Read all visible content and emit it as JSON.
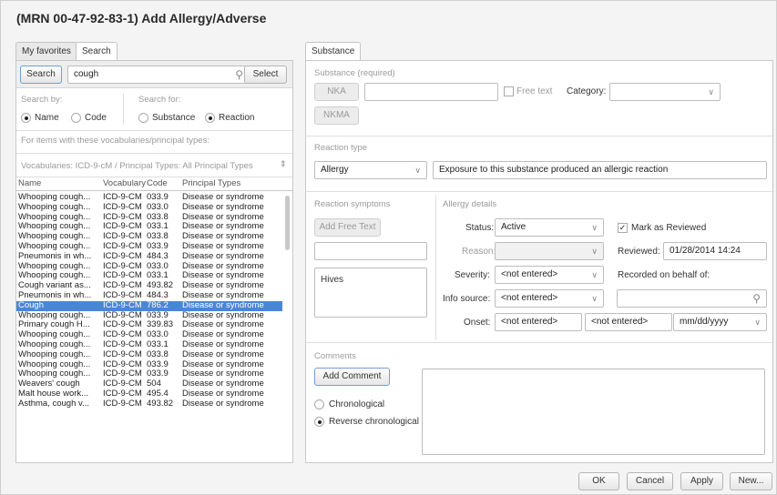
{
  "title": "(MRN 00-47-92-83-1) Add Allergy/Adverse",
  "left_tabs": [
    "My favorites",
    "Search"
  ],
  "search": {
    "button": "Search",
    "query": "cough",
    "select_button": "Select"
  },
  "search_by": {
    "label": "Search by:",
    "options": [
      "Name",
      "Code"
    ]
  },
  "search_for": {
    "label": "Search for:",
    "options": [
      "Substance",
      "Reaction"
    ]
  },
  "vocab_note": "For items with these vocabularies/principal types:",
  "vocab_select": "Vocabularies: ICD-9-cM / Principal Types: All Principal Types",
  "results": {
    "headers": [
      "Name",
      "Vocabulary",
      "Code",
      "Principal Types"
    ],
    "rows": [
      [
        "Whooping cough...",
        "ICD-9-CM",
        "033.9",
        "Disease or syndrome"
      ],
      [
        "Whooping cough...",
        "ICD-9-CM",
        "033.0",
        "Disease or syndrome"
      ],
      [
        "Whooping cough...",
        "ICD-9-CM",
        "033.8",
        "Disease or syndrome"
      ],
      [
        "Whooping cough...",
        "ICD-9-CM",
        "033.1",
        "Disease or syndrome"
      ],
      [
        "Whooping cough...",
        "ICD-9-CM",
        "033.8",
        "Disease or syndrome"
      ],
      [
        "Whooping cough...",
        "ICD-9-CM",
        "033.9",
        "Disease or syndrome"
      ],
      [
        "Pneumonis in wh...",
        "ICD-9-CM",
        "484.3",
        "Disease or syndrome"
      ],
      [
        "Whooping cough...",
        "ICD-9-CM",
        "033.0",
        "Disease or syndrome"
      ],
      [
        "Whooping cough...",
        "ICD-9-CM",
        "033.1",
        "Disease or syndrome"
      ],
      [
        "Cough variant as...",
        "ICD-9-CM",
        "493.82",
        "Disease or syndrome"
      ],
      [
        "Pneumonis in wh...",
        "ICD-9-CM",
        "484.3",
        "Disease or syndrome"
      ],
      [
        "Cough",
        "ICD-9-CM",
        "786.2",
        "Disease or syndrome"
      ],
      [
        "Whooping cough...",
        "ICD-9-CM",
        "033.9",
        "Disease or syndrome"
      ],
      [
        "Primary cough H...",
        "ICD-9-CM",
        "339.83",
        "Disease or syndrome"
      ],
      [
        "Whooping cough...",
        "ICD-9-CM",
        "033.0",
        "Disease or syndrome"
      ],
      [
        "Whooping cough...",
        "ICD-9-CM",
        "033.1",
        "Disease or syndrome"
      ],
      [
        "Whooping cough...",
        "ICD-9-CM",
        "033.8",
        "Disease or syndrome"
      ],
      [
        "Whooping cough...",
        "ICD-9-CM",
        "033.9",
        "Disease or syndrome"
      ],
      [
        "Whooping cough...",
        "ICD-9-CM",
        "033.9",
        "Disease or syndrome"
      ],
      [
        "Weavers' cough",
        "ICD-9-CM",
        "504",
        "Disease or syndrome"
      ],
      [
        "Malt house work...",
        "ICD-9-CM",
        "495.4",
        "Disease or syndrome"
      ],
      [
        "Asthma, cough v...",
        "ICD-9-CM",
        "493.82",
        "Disease or syndrome"
      ]
    ],
    "selected_index": 11
  },
  "right_tab": "Substance",
  "substance": {
    "section": "Substance (required)",
    "nka": "NKA",
    "nkma": "NKMA",
    "free_text": "Free text",
    "category_label": "Category:",
    "category_value": ""
  },
  "reaction_type": {
    "section": "Reaction type",
    "value": "Allergy",
    "description": "Exposure to this substance produced an allergic reaction"
  },
  "symptoms": {
    "section": "Reaction symptoms",
    "add_button": "Add Free Text",
    "input": "",
    "items": [
      "Hives"
    ]
  },
  "details": {
    "section": "Allergy details",
    "status_label": "Status:",
    "status_value": "Active",
    "reason_label": "Reason:",
    "reason_value": "",
    "severity_label": "Severity:",
    "severity_value": "<not entered>",
    "info_label": "Info source:",
    "info_value": "<not entered>",
    "onset_label": "Onset:",
    "onset_value1": "<not entered>",
    "onset_value2": "<not entered>",
    "onset_date": "mm/dd/yyyy",
    "mark_reviewed": "Mark as Reviewed",
    "reviewed_label": "Reviewed:",
    "reviewed_value": "01/28/2014 14:24",
    "behalf_label": "Recorded on behalf of:",
    "behalf_value": ""
  },
  "comments": {
    "section": "Comments",
    "add_button": "Add Comment",
    "orders": [
      "Chronological",
      "Reverse chronological"
    ],
    "text": ""
  },
  "footer": {
    "ok": "OK",
    "cancel": "Cancel",
    "apply": "Apply",
    "new": "New..."
  }
}
